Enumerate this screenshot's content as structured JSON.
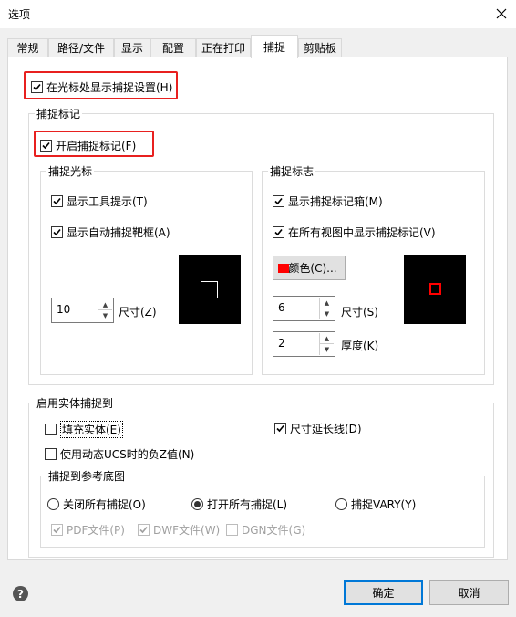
{
  "window": {
    "title": "选项"
  },
  "tabs": [
    {
      "label": "常规"
    },
    {
      "label": "路径/文件"
    },
    {
      "label": "显示"
    },
    {
      "label": "配置"
    },
    {
      "label": "正在打印"
    },
    {
      "label": "捕捉"
    },
    {
      "label": "剪贴板"
    }
  ],
  "active_tab": "捕捉",
  "show_snap_settings": {
    "label": "在光标处显示捕捉设置(H)",
    "checked": true
  },
  "snap_marker": {
    "group_label": "捕捉标记",
    "enable": {
      "label": "开启捕捉标记(F)",
      "checked": true
    },
    "cursor": {
      "group_label": "捕捉光标",
      "show_tooltip": {
        "label": "显示工具提示(T)",
        "checked": true
      },
      "show_auto_aperture": {
        "label": "显示自动捕捉靶框(A)",
        "checked": true
      },
      "size_value": "10",
      "size_label": "尺寸(Z)"
    },
    "marker": {
      "group_label": "捕捉标志",
      "show_marker_box": {
        "label": "显示捕捉标记箱(M)",
        "checked": true
      },
      "show_in_all_views": {
        "label": "在所有视图中显示捕捉标记(V)",
        "checked": true
      },
      "color_button": "颜色(C)...",
      "color": "#ff0000",
      "size_value": "6",
      "size_label": "尺寸(S)",
      "thickness_value": "2",
      "thickness_label": "厚度(K)"
    }
  },
  "entity_snap": {
    "group_label": "启用实体捕捉到",
    "fill_solid": {
      "label": "填充实体(E)",
      "checked": false
    },
    "dimension_extension": {
      "label": "尺寸延长线(D)",
      "checked": true
    },
    "ucs_negative_z": {
      "label": "使用动态UCS时的负Z值(N)",
      "checked": false
    },
    "reference": {
      "group_label": "捕捉到参考底图",
      "close_all": {
        "label": "关闭所有捕捉(O)",
        "selected": false
      },
      "open_all": {
        "label": "打开所有捕捉(L)",
        "selected": true
      },
      "snap_vary": {
        "label": "捕捉VARY(Y)",
        "selected": false
      },
      "pdf": {
        "label": "PDF文件(P)",
        "checked": true
      },
      "dwf": {
        "label": "DWF文件(W)",
        "checked": true
      },
      "dgn": {
        "label": "DGN文件(G)",
        "checked": false
      }
    }
  },
  "buttons": {
    "ok": "确定",
    "cancel": "取消"
  },
  "colors": {
    "highlight": "#e8201f",
    "accent": "#0078d7",
    "preview_bg": "#000000"
  }
}
